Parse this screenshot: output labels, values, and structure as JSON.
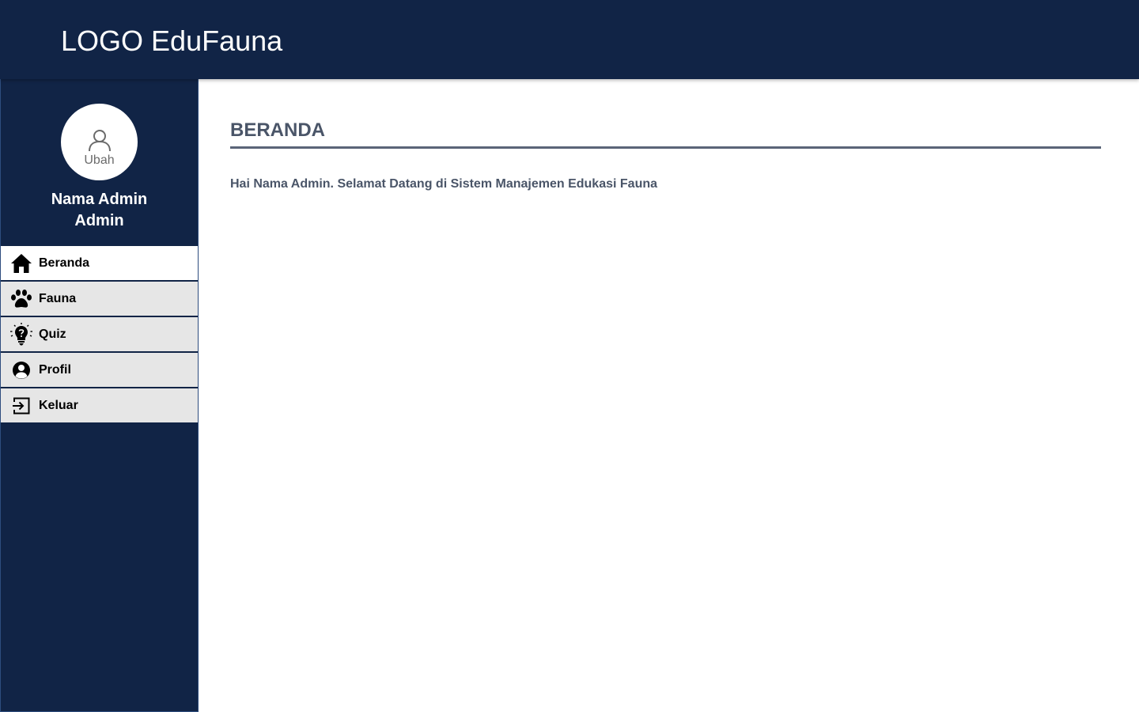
{
  "header": {
    "logo_text": "LOGO EduFauna",
    "background": "#112446"
  },
  "sidebar": {
    "avatar": {
      "icon": "user-outline-icon",
      "edit_label": "Ubah"
    },
    "admin_name": "Nama Admin",
    "admin_role": "Admin",
    "items": [
      {
        "label": "Beranda",
        "icon": "home-icon",
        "active": true
      },
      {
        "label": "Fauna",
        "icon": "paw-icon",
        "active": false
      },
      {
        "label": "Quiz",
        "icon": "lightbulb-question-icon",
        "active": false
      },
      {
        "label": "Profil",
        "icon": "user-circle-icon",
        "active": false
      },
      {
        "label": "Keluar",
        "icon": "logout-icon",
        "active": false
      }
    ]
  },
  "main": {
    "title": "BERANDA",
    "welcome_text": "Hai Nama Admin. Selamat Datang di Sistem Manajemen Edukasi Fauna"
  },
  "colors": {
    "navy": "#112446",
    "menu_bg": "#e6e6e6",
    "active_bg": "#ffffff",
    "title_text": "#4a5568"
  }
}
